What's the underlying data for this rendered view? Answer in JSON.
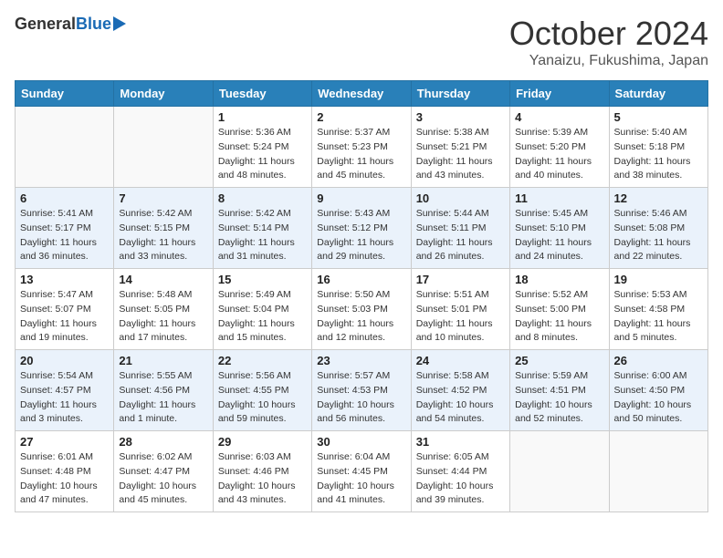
{
  "header": {
    "logo_general": "General",
    "logo_blue": "Blue",
    "month": "October 2024",
    "location": "Yanaizu, Fukushima, Japan"
  },
  "weekdays": [
    "Sunday",
    "Monday",
    "Tuesday",
    "Wednesday",
    "Thursday",
    "Friday",
    "Saturday"
  ],
  "weeks": [
    [
      {
        "day": "",
        "info": ""
      },
      {
        "day": "",
        "info": ""
      },
      {
        "day": "1",
        "info": "Sunrise: 5:36 AM\nSunset: 5:24 PM\nDaylight: 11 hours and 48 minutes."
      },
      {
        "day": "2",
        "info": "Sunrise: 5:37 AM\nSunset: 5:23 PM\nDaylight: 11 hours and 45 minutes."
      },
      {
        "day": "3",
        "info": "Sunrise: 5:38 AM\nSunset: 5:21 PM\nDaylight: 11 hours and 43 minutes."
      },
      {
        "day": "4",
        "info": "Sunrise: 5:39 AM\nSunset: 5:20 PM\nDaylight: 11 hours and 40 minutes."
      },
      {
        "day": "5",
        "info": "Sunrise: 5:40 AM\nSunset: 5:18 PM\nDaylight: 11 hours and 38 minutes."
      }
    ],
    [
      {
        "day": "6",
        "info": "Sunrise: 5:41 AM\nSunset: 5:17 PM\nDaylight: 11 hours and 36 minutes."
      },
      {
        "day": "7",
        "info": "Sunrise: 5:42 AM\nSunset: 5:15 PM\nDaylight: 11 hours and 33 minutes."
      },
      {
        "day": "8",
        "info": "Sunrise: 5:42 AM\nSunset: 5:14 PM\nDaylight: 11 hours and 31 minutes."
      },
      {
        "day": "9",
        "info": "Sunrise: 5:43 AM\nSunset: 5:12 PM\nDaylight: 11 hours and 29 minutes."
      },
      {
        "day": "10",
        "info": "Sunrise: 5:44 AM\nSunset: 5:11 PM\nDaylight: 11 hours and 26 minutes."
      },
      {
        "day": "11",
        "info": "Sunrise: 5:45 AM\nSunset: 5:10 PM\nDaylight: 11 hours and 24 minutes."
      },
      {
        "day": "12",
        "info": "Sunrise: 5:46 AM\nSunset: 5:08 PM\nDaylight: 11 hours and 22 minutes."
      }
    ],
    [
      {
        "day": "13",
        "info": "Sunrise: 5:47 AM\nSunset: 5:07 PM\nDaylight: 11 hours and 19 minutes."
      },
      {
        "day": "14",
        "info": "Sunrise: 5:48 AM\nSunset: 5:05 PM\nDaylight: 11 hours and 17 minutes."
      },
      {
        "day": "15",
        "info": "Sunrise: 5:49 AM\nSunset: 5:04 PM\nDaylight: 11 hours and 15 minutes."
      },
      {
        "day": "16",
        "info": "Sunrise: 5:50 AM\nSunset: 5:03 PM\nDaylight: 11 hours and 12 minutes."
      },
      {
        "day": "17",
        "info": "Sunrise: 5:51 AM\nSunset: 5:01 PM\nDaylight: 11 hours and 10 minutes."
      },
      {
        "day": "18",
        "info": "Sunrise: 5:52 AM\nSunset: 5:00 PM\nDaylight: 11 hours and 8 minutes."
      },
      {
        "day": "19",
        "info": "Sunrise: 5:53 AM\nSunset: 4:58 PM\nDaylight: 11 hours and 5 minutes."
      }
    ],
    [
      {
        "day": "20",
        "info": "Sunrise: 5:54 AM\nSunset: 4:57 PM\nDaylight: 11 hours and 3 minutes."
      },
      {
        "day": "21",
        "info": "Sunrise: 5:55 AM\nSunset: 4:56 PM\nDaylight: 11 hours and 1 minute."
      },
      {
        "day": "22",
        "info": "Sunrise: 5:56 AM\nSunset: 4:55 PM\nDaylight: 10 hours and 59 minutes."
      },
      {
        "day": "23",
        "info": "Sunrise: 5:57 AM\nSunset: 4:53 PM\nDaylight: 10 hours and 56 minutes."
      },
      {
        "day": "24",
        "info": "Sunrise: 5:58 AM\nSunset: 4:52 PM\nDaylight: 10 hours and 54 minutes."
      },
      {
        "day": "25",
        "info": "Sunrise: 5:59 AM\nSunset: 4:51 PM\nDaylight: 10 hours and 52 minutes."
      },
      {
        "day": "26",
        "info": "Sunrise: 6:00 AM\nSunset: 4:50 PM\nDaylight: 10 hours and 50 minutes."
      }
    ],
    [
      {
        "day": "27",
        "info": "Sunrise: 6:01 AM\nSunset: 4:48 PM\nDaylight: 10 hours and 47 minutes."
      },
      {
        "day": "28",
        "info": "Sunrise: 6:02 AM\nSunset: 4:47 PM\nDaylight: 10 hours and 45 minutes."
      },
      {
        "day": "29",
        "info": "Sunrise: 6:03 AM\nSunset: 4:46 PM\nDaylight: 10 hours and 43 minutes."
      },
      {
        "day": "30",
        "info": "Sunrise: 6:04 AM\nSunset: 4:45 PM\nDaylight: 10 hours and 41 minutes."
      },
      {
        "day": "31",
        "info": "Sunrise: 6:05 AM\nSunset: 4:44 PM\nDaylight: 10 hours and 39 minutes."
      },
      {
        "day": "",
        "info": ""
      },
      {
        "day": "",
        "info": ""
      }
    ]
  ]
}
